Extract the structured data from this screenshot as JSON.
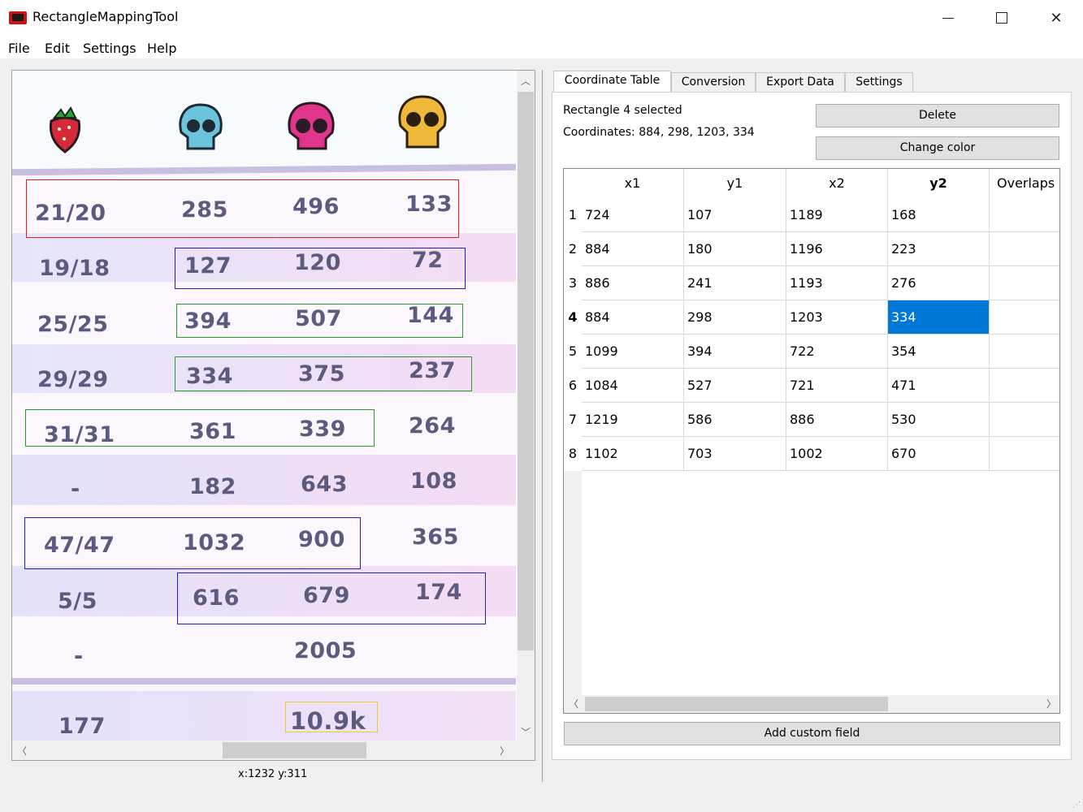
{
  "window": {
    "title": "RectangleMappingTool",
    "minimize": "—",
    "maximize": "☐",
    "close": "✕"
  },
  "menu": [
    "File",
    "Edit",
    "Settings",
    "Help"
  ],
  "image": {
    "rows": [
      [
        "21/20",
        "285",
        "496",
        "133"
      ],
      [
        "19/18",
        "127",
        "120",
        "72"
      ],
      [
        "25/25",
        "394",
        "507",
        "144"
      ],
      [
        "29/29",
        "334",
        "375",
        "237"
      ],
      [
        "31/31",
        "361",
        "339",
        "264"
      ],
      [
        "-",
        "182",
        "643",
        "108"
      ],
      [
        "47/47",
        "1032",
        "900",
        "365"
      ],
      [
        "5/5",
        "616",
        "679",
        "174"
      ],
      [
        "-",
        "",
        "2005",
        ""
      ],
      [
        "177",
        "",
        "10.9k",
        ""
      ]
    ],
    "icons": [
      "strawberry-icon",
      "blue-skull-icon",
      "pink-skull-icon",
      "gold-skull-icon"
    ],
    "rect_colors": {
      "red": "#e02020",
      "blue": "#2020d0",
      "green": "#20a020",
      "yellow": "#e8d030"
    }
  },
  "status": {
    "cursor": "x:1232 y:311"
  },
  "tabs": [
    "Coordinate Table",
    "Conversion",
    "Export Data",
    "Settings"
  ],
  "info": {
    "selected": "Rectangle 4 selected",
    "coordinates": "Coordinates: 884, 298, 1203, 334"
  },
  "buttons": {
    "delete": "Delete",
    "change_color": "Change color",
    "add_custom_field": "Add custom field"
  },
  "table": {
    "headers": [
      "x1",
      "y1",
      "x2",
      "y2",
      "Overlaps w"
    ],
    "rows": [
      [
        "1",
        "724",
        "107",
        "1189",
        "168",
        ""
      ],
      [
        "2",
        "884",
        "180",
        "1196",
        "223",
        ""
      ],
      [
        "3",
        "886",
        "241",
        "1193",
        "276",
        ""
      ],
      [
        "4",
        "884",
        "298",
        "1203",
        "334",
        ""
      ],
      [
        "5",
        "1099",
        "394",
        "722",
        "354",
        ""
      ],
      [
        "6",
        "1084",
        "527",
        "721",
        "471",
        ""
      ],
      [
        "7",
        "1219",
        "586",
        "886",
        "530",
        ""
      ],
      [
        "8",
        "1102",
        "703",
        "1002",
        "670",
        ""
      ]
    ],
    "selected_row": "4",
    "selected_col": "y2"
  },
  "colors": {
    "selection": "#0078d7",
    "number_text": "#5d5a80"
  }
}
